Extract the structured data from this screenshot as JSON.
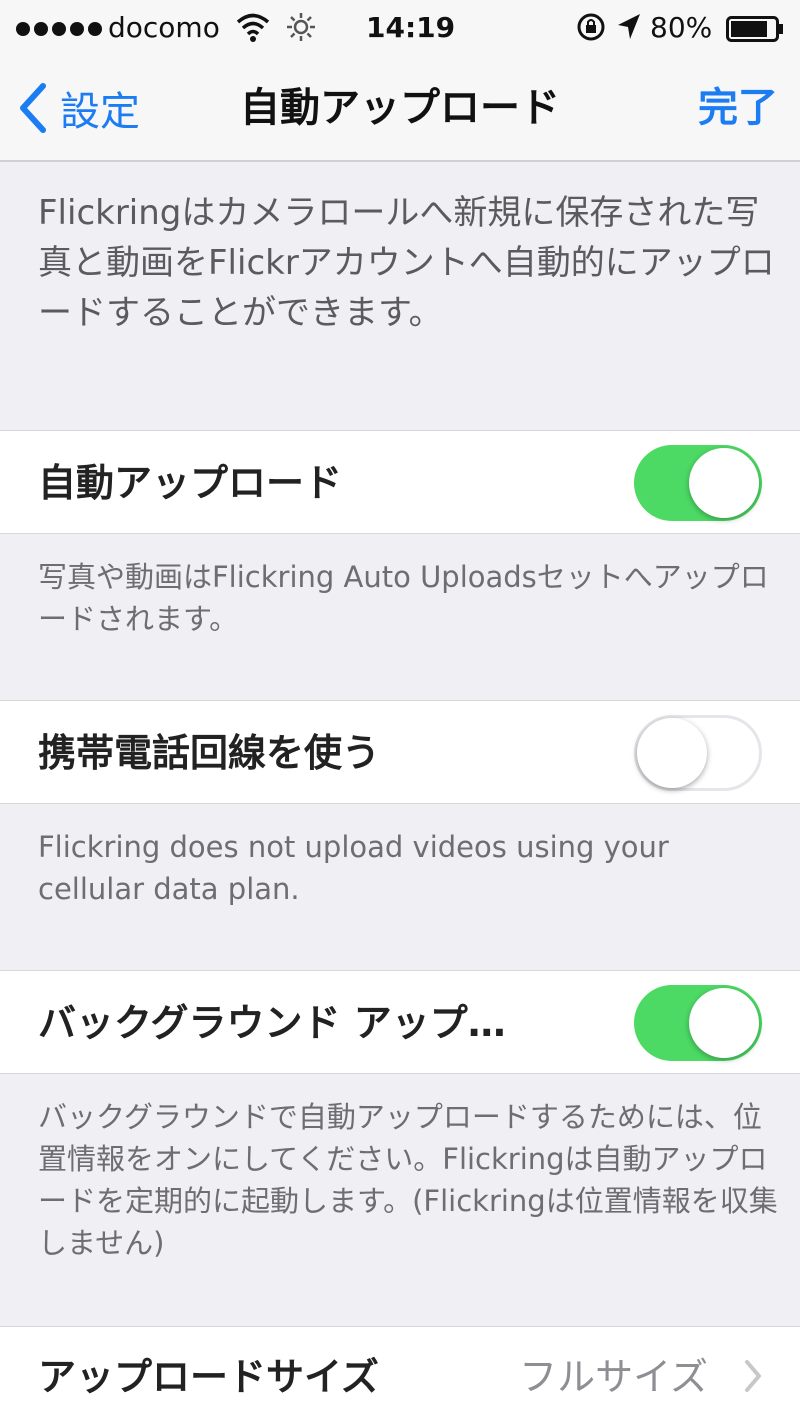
{
  "status_bar": {
    "carrier": "docomo",
    "time": "14:19",
    "battery": "80%"
  },
  "nav": {
    "back_label": "設定",
    "title": "自動アップロード",
    "done_label": "完了"
  },
  "intro_text": "Flickringはカメラロールへ新規に保存された写真と動画をFlickrアカウントへ自動的にアップロードすることができます。",
  "settings": [
    {
      "label": "自動アップロード",
      "on": true,
      "note": "写真や動画はFlickring Auto Uploadsセットへアップロードされます。"
    },
    {
      "label": "携帯電話回線を使う",
      "on": false,
      "note": "Flickring does not upload videos using your cellular data plan."
    },
    {
      "label": "バックグラウンド アップ…",
      "on": true,
      "note": "バックグラウンドで自動アップロードするためには、位置情報をオンにしてください。Flickringは自動アップロードを定期的に起動します。(Flickringは位置情報を収集しません)"
    }
  ],
  "upload_size": {
    "label": "アップロードサイズ",
    "value": "フルサイズ"
  },
  "colors": {
    "accent": "#1c7cf2",
    "toggle_on": "#4cd964",
    "background": "#efeff4"
  }
}
